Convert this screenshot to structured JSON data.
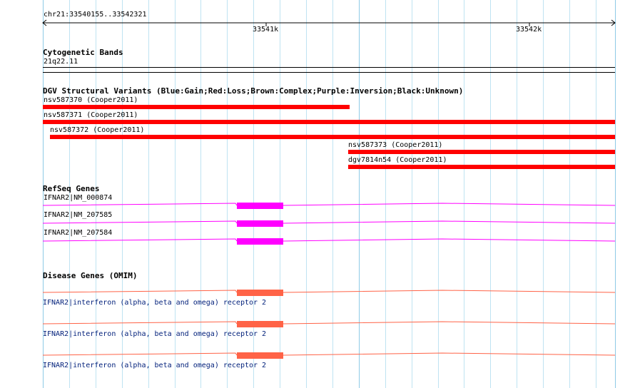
{
  "ruler": {
    "region": "chr21:33540155..33542321",
    "ticks": [
      {
        "label": "33541k"
      },
      {
        "label": "33542k"
      }
    ]
  },
  "cytoband": {
    "title": "Cytogenetic Bands",
    "band": "21q22.11"
  },
  "dgv": {
    "title": "DGV Structural Variants (Blue:Gain;Red:Loss;Brown:Complex;Purple:Inversion;Black:Unknown)",
    "features": [
      {
        "label": "nsv587370 (Cooper2011)",
        "color": "#ff0000"
      },
      {
        "label": "nsv587371 (Cooper2011)",
        "color": "#ff0000"
      },
      {
        "label": "nsv587372 (Cooper2011)",
        "color": "#ff0000"
      },
      {
        "label": "nsv587373 (Cooper2011)",
        "color": "#ff0000"
      },
      {
        "label": "dgv7814n54 (Cooper2011)",
        "color": "#ff0000"
      }
    ]
  },
  "refseq": {
    "title": "RefSeq Genes",
    "color": "#ff00ff",
    "genes": [
      {
        "label": "IFNAR2|NM_000874"
      },
      {
        "label": "IFNAR2|NM_207585"
      },
      {
        "label": "IFNAR2|NM_207584"
      }
    ]
  },
  "omim": {
    "title": "Disease Genes (OMIM)",
    "color": "#ff6347",
    "genes": [
      {
        "label": "IFNAR2|interferon (alpha, beta and omega) receptor 2"
      },
      {
        "label": "IFNAR2|interferon (alpha, beta and omega) receptor 2"
      },
      {
        "label": "IFNAR2|interferon (alpha, beta and omega) receptor 2"
      }
    ]
  }
}
